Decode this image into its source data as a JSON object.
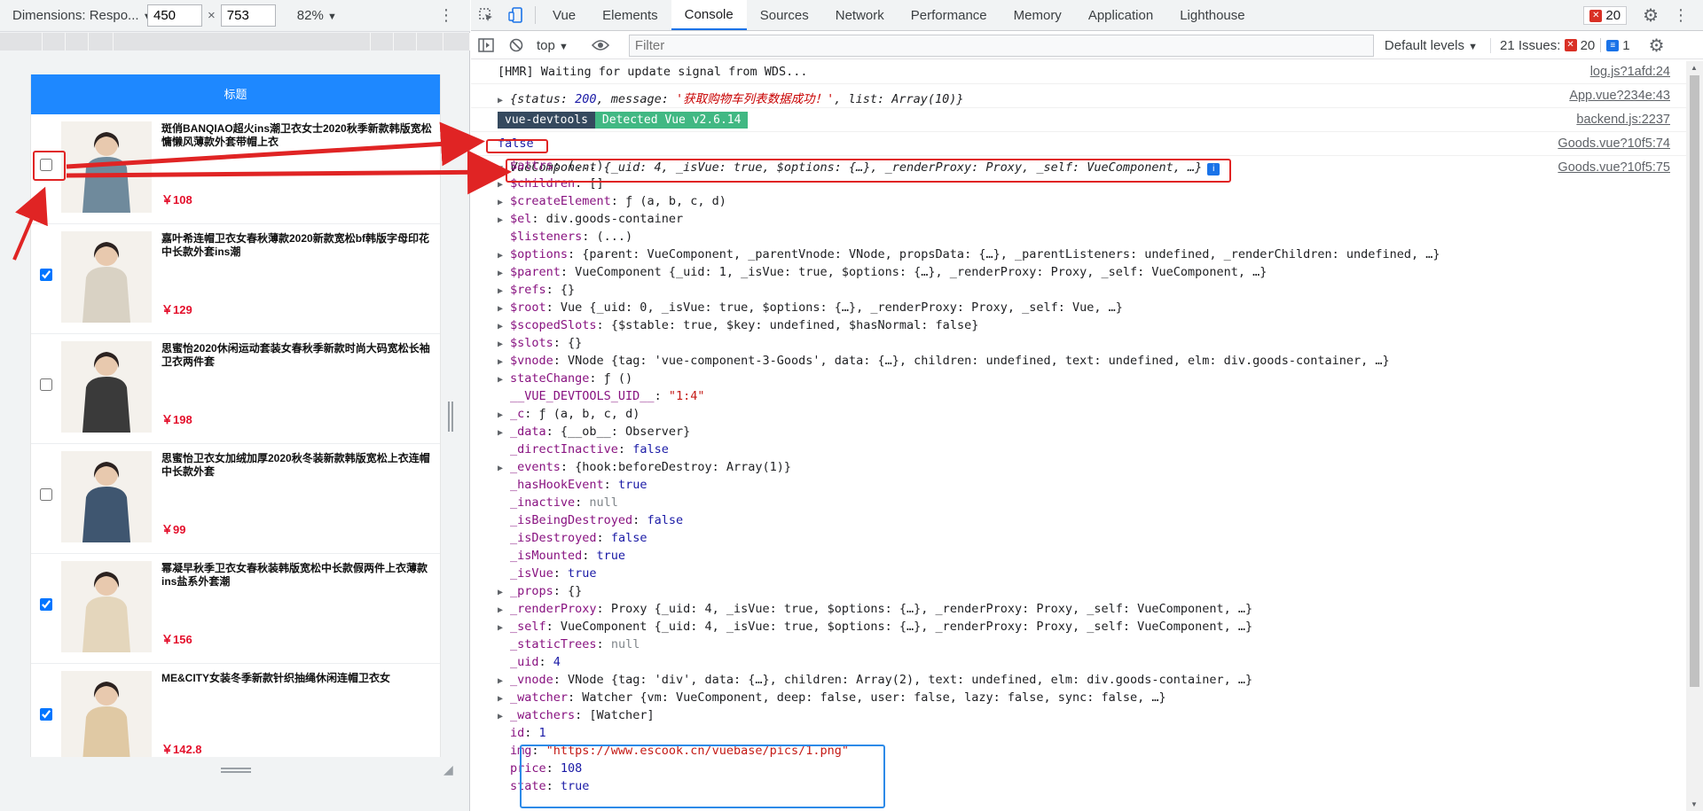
{
  "device_toolbar": {
    "dimensions_label": "Dimensions: Respo...",
    "width": "450",
    "height": "753",
    "zoom": "82%"
  },
  "app": {
    "header_title": "标题",
    "goods": [
      {
        "title": "斑俏BANQIAO超火ins潮卫衣女士2020秋季新款韩版宽松慵懒风薄款外套带帽上衣",
        "price": "￥108",
        "checked": false,
        "thumb_color": "#6f8a9c"
      },
      {
        "title": "嘉叶希连帽卫衣女春秋薄款2020新款宽松bf韩版字母印花中长款外套ins潮",
        "price": "￥129",
        "checked": true,
        "thumb_color": "#d9d2c4"
      },
      {
        "title": "思蜜怡2020休闲运动套装女春秋季新款时尚大码宽松长袖卫衣两件套",
        "price": "￥198",
        "checked": false,
        "thumb_color": "#3a3a3a"
      },
      {
        "title": "思蜜怡卫衣女加绒加厚2020秋冬装新款韩版宽松上衣连帽中长款外套",
        "price": "￥99",
        "checked": false,
        "thumb_color": "#3f5670"
      },
      {
        "title": "幂凝早秋季卫衣女春秋装韩版宽松中长款假两件上衣薄款ins盐系外套潮",
        "price": "￥156",
        "checked": true,
        "thumb_color": "#e4d6bc"
      },
      {
        "title": "ME&CITY女装冬季新款针织抽绳休闲连帽卫衣女",
        "price": "￥142.8",
        "checked": true,
        "thumb_color": "#e0c9a4"
      }
    ]
  },
  "devtools": {
    "tabs": [
      "Vue",
      "Elements",
      "Console",
      "Sources",
      "Network",
      "Performance",
      "Memory",
      "Application",
      "Lighthouse"
    ],
    "active_tab": "Console",
    "error_count": "20",
    "context": "top",
    "filter_placeholder": "Filter",
    "levels": "Default levels",
    "issues_label": "21 Issues:",
    "issues_errors": "20",
    "issues_messages": "1"
  },
  "console": {
    "hmr": {
      "text": "[HMR] Waiting for update signal from WDS...",
      "source": "log.js?1afd:24"
    },
    "status_line": {
      "prefix": "{status: ",
      "status": "200",
      "mid": ", message: ",
      "message": "'获取购物车列表数据成功！'",
      "list_key": ", list: ",
      "list": "Array(10)",
      "suffix": "}",
      "source": "App.vue?234e:43"
    },
    "devtools_line": {
      "badge": "vue-devtools",
      "detected": "Detected Vue v2.6.14",
      "source": "backend.js:2237"
    },
    "false_line": {
      "text": "false",
      "source": "Goods.vue?10f5:74"
    },
    "component_line": {
      "text": "VueComponent {_uid: 4, _isVue: true, $options: {…}, _renderProxy: Proxy, _self: VueComponent, …}",
      "info": "i",
      "source": "Goods.vue?10f5:75"
    },
    "properties": [
      {
        "key": "$attrs",
        "value": "(...)",
        "expand": false
      },
      {
        "key": "$children",
        "value": "[]",
        "expand": true
      },
      {
        "key": "$createElement",
        "value": "ƒ (a, b, c, d)",
        "expand": true
      },
      {
        "key": "$el",
        "value": "div.goods-container",
        "expand": true
      },
      {
        "key": "$listeners",
        "value": "(...)",
        "expand": false
      },
      {
        "key": "$options",
        "value": "{parent: VueComponent, _parentVnode: VNode, propsData: {…}, _parentListeners: undefined, _renderChildren: undefined, …}",
        "expand": true
      },
      {
        "key": "$parent",
        "value": "VueComponent {_uid: 1, _isVue: true, $options: {…}, _renderProxy: Proxy, _self: VueComponent, …}",
        "expand": true
      },
      {
        "key": "$refs",
        "value": "{}",
        "expand": true
      },
      {
        "key": "$root",
        "value": "Vue {_uid: 0, _isVue: true, $options: {…}, _renderProxy: Proxy, _self: Vue, …}",
        "expand": true
      },
      {
        "key": "$scopedSlots",
        "value": "{$stable: true, $key: undefined, $hasNormal: false}",
        "expand": true
      },
      {
        "key": "$slots",
        "value": "{}",
        "expand": true
      },
      {
        "key": "$vnode",
        "value": "VNode {tag: 'vue-component-3-Goods', data: {…}, children: undefined, text: undefined, elm: div.goods-container, …}",
        "expand": true
      },
      {
        "key": "stateChange",
        "value": "ƒ ()",
        "expand": true
      },
      {
        "key": "__VUE_DEVTOOLS_UID__",
        "value": "\"1:4\"",
        "expand": false
      },
      {
        "key": "_c",
        "value": "ƒ (a, b, c, d)",
        "expand": true
      },
      {
        "key": "_data",
        "value": "{__ob__: Observer}",
        "expand": true
      },
      {
        "key": "_directInactive",
        "value": "false",
        "expand": false
      },
      {
        "key": "_events",
        "value": "{hook:beforeDestroy: Array(1)}",
        "expand": true
      },
      {
        "key": "_hasHookEvent",
        "value": "true",
        "expand": false
      },
      {
        "key": "_inactive",
        "value": "null",
        "expand": false
      },
      {
        "key": "_isBeingDestroyed",
        "value": "false",
        "expand": false
      },
      {
        "key": "_isDestroyed",
        "value": "false",
        "expand": false
      },
      {
        "key": "_isMounted",
        "value": "true",
        "expand": false
      },
      {
        "key": "_isVue",
        "value": "true",
        "expand": false
      },
      {
        "key": "_props",
        "value": "{}",
        "expand": true
      },
      {
        "key": "_renderProxy",
        "value": "Proxy {_uid: 4, _isVue: true, $options: {…}, _renderProxy: Proxy, _self: VueComponent, …}",
        "expand": true
      },
      {
        "key": "_self",
        "value": "VueComponent {_uid: 4, _isVue: true, $options: {…}, _renderProxy: Proxy, _self: VueComponent, …}",
        "expand": true
      },
      {
        "key": "_staticTrees",
        "value": "null",
        "expand": false
      },
      {
        "key": "_uid",
        "value": "4",
        "expand": false
      },
      {
        "key": "_vnode",
        "value": "VNode {tag: 'div', data: {…}, children: Array(2), text: undefined, elm: div.goods-container, …}",
        "expand": true
      },
      {
        "key": "_watcher",
        "value": "Watcher {vm: VueComponent, deep: false, user: false, lazy: false, sync: false, …}",
        "expand": true
      },
      {
        "key": "_watchers",
        "value": "[Watcher]",
        "expand": true
      },
      {
        "key": "id",
        "value": "1",
        "expand": false
      },
      {
        "key": "img",
        "value": "\"https://www.escook.cn/vuebase/pics/1.png\"",
        "expand": false
      },
      {
        "key": "price",
        "value": "108",
        "expand": false
      },
      {
        "key": "state",
        "value": "true",
        "expand": false
      }
    ]
  },
  "colors": {
    "annotation_red": "#e02424",
    "annotation_blue": "#2d8ae8",
    "vue_green": "#41b883",
    "header_blue": "#1e88ff",
    "price_red": "#e4102c"
  }
}
